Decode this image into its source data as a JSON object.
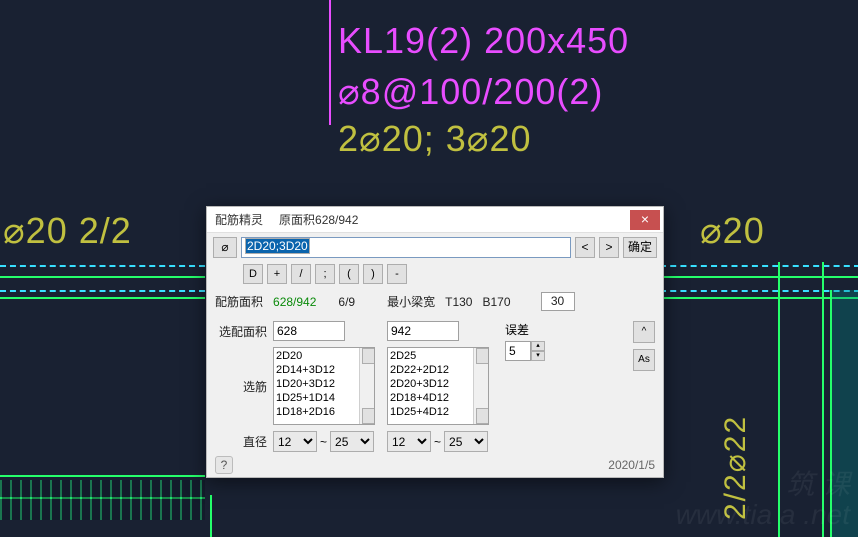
{
  "cad": {
    "beam_label": "KL19(2) 200x450",
    "stirrup": "⌀8@100/200(2)",
    "rebar": "2⌀20; 3⌀20",
    "left_text": "⌀20 2/2",
    "right_text": "⌀20",
    "right_vert": "2/2⌀22"
  },
  "watermark": {
    "l1": "筑 课",
    "l2": "www.tia   a .net"
  },
  "dialog": {
    "title": "配筋精灵",
    "subtitle": "原面积628/942",
    "close": "×",
    "phi_btn": "⌀",
    "rebar_value": "2D20;3D20",
    "nav_prev": "<",
    "nav_next": ">",
    "ok": "确定",
    "tools": {
      "D": "D",
      "plus": "+",
      "slash": "/",
      "semi": ";",
      "lpar": "(",
      "rpar": ")",
      "minus": "-"
    },
    "area_label": "配筋面积",
    "area_value": "628/942",
    "page": "6/9",
    "min_beam_label": "最小梁宽",
    "min_beam_T": "T130",
    "min_beam_B": "B170",
    "min_beam_box": "30",
    "pick_area_label": "选配面积",
    "pick_area_1": "628",
    "pick_area_2": "942",
    "pick_rebar_label": "选筋",
    "list1": [
      "2D20",
      "2D14+3D12",
      "1D20+3D12",
      "1D25+1D14",
      "1D18+2D16"
    ],
    "list2": [
      "2D25",
      "2D22+2D12",
      "2D20+3D12",
      "2D18+4D12",
      "1D25+4D12"
    ],
    "diameter_label": "直径",
    "tilde": "~",
    "dia_1a": "12",
    "dia_1b": "25",
    "dia_2a": "12",
    "dia_2b": "25",
    "err_label": "误差",
    "err_value": "5",
    "err_up": "▴",
    "err_dn": "▾",
    "side_up": "^",
    "side_as": "As",
    "help": "?",
    "date": "2020/1/5"
  }
}
